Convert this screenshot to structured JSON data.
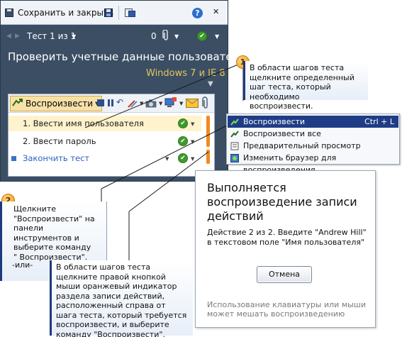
{
  "runner": {
    "save_close_label": "Сохранить и закрыть",
    "test_counter": "Тест 1 из 1",
    "attachments_count": "0",
    "title": "Проверить учетные данные пользователя",
    "environment": "Windows 7 и IE 8",
    "toolbar": {
      "play_label": "Воспроизвести"
    },
    "steps": [
      {
        "label": "1. Ввести имя пользователя"
      },
      {
        "label": "2. Ввести пароль"
      },
      {
        "label": "Закончить тест"
      }
    ]
  },
  "context_menu": {
    "items": [
      {
        "label": "Воспроизвести",
        "shortcut": "Ctrl + L"
      },
      {
        "label": "Воспроизвести все",
        "shortcut": ""
      },
      {
        "label": "Предварительный просмотр",
        "shortcut": ""
      },
      {
        "label": "Изменить браузер для воспроизведения",
        "shortcut": ""
      }
    ]
  },
  "dialog": {
    "title": "Выполняется воспроизведение записи действий",
    "body": "Действие 2 из 2. Введите \"Andrew Hill\" в текстовом поле \"Имя пользователя\"",
    "cancel_label": "Отмена",
    "note": "Использование клавиатуры или мыши может мешать воспроизведению"
  },
  "callouts": {
    "one": {
      "badge": "1",
      "text": "В области шагов теста щелкните определенный шаг теста, который необходимо воспроизвести."
    },
    "two": {
      "badge": "2",
      "text": "Щелкните \"Воспроизвести\" на панели инструментов и выберите команду \" Воспроизвести\"."
    },
    "or_text": "-или-",
    "three": {
      "text": "В области шагов теста щелкните правой кнопкой мыши оранжевый индикатор раздела записи действий, расположенный справа от шага теста, который требуется воспроизвести, и выберите команду \"Воспроизвести\"."
    }
  },
  "colors": {
    "panel_bg": "#3b4e63",
    "accent_orange": "#f08a1f",
    "env_text": "#e3c85c",
    "menu_highlight": "#1f3d86",
    "check_green": "#3f9a2c"
  },
  "icons": {
    "save": "save-icon",
    "save_alt": "floppy-icon",
    "clipboard": "clipboard-icon",
    "help": "help-icon",
    "back": "back-icon",
    "attachment": "paperclip-icon",
    "pass": "check-circle-icon",
    "play": "play-icon"
  }
}
